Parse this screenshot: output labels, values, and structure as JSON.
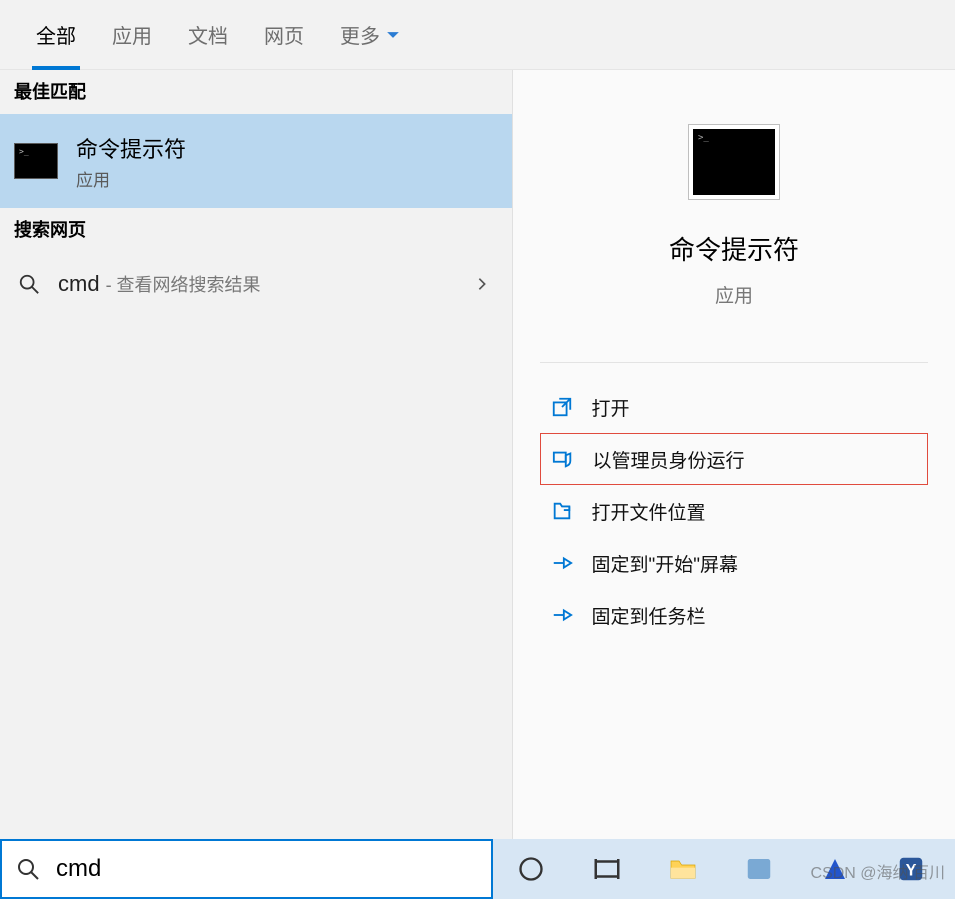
{
  "tabs": {
    "all": "全部",
    "apps": "应用",
    "docs": "文档",
    "web": "网页",
    "more": "更多"
  },
  "left": {
    "best_match_header": "最佳匹配",
    "best_match": {
      "title": "命令提示符",
      "subtitle": "应用"
    },
    "search_web_header": "搜索网页",
    "web_result": {
      "query": "cmd",
      "hint": "- 查看网络搜索结果"
    }
  },
  "preview": {
    "title": "命令提示符",
    "subtitle": "应用",
    "actions": {
      "open": "打开",
      "run_admin": "以管理员身份运行",
      "open_location": "打开文件位置",
      "pin_start": "固定到\"开始\"屏幕",
      "pin_taskbar": "固定到任务栏"
    }
  },
  "search": {
    "value": "cmd"
  },
  "watermark": "CSDN @海纳 百川"
}
